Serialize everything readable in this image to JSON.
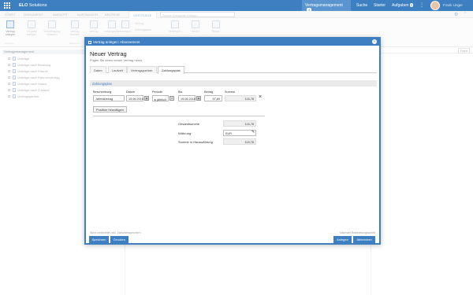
{
  "topbar": {
    "brand_strong": "ELO",
    "brand_rest": "Solutions",
    "module": "Vertragsmanagement",
    "module_badge": "4",
    "nav": [
      "Suche",
      "Starter",
      "Aufgaben"
    ],
    "tasks_badge": "0",
    "more": "⋮",
    "user": "Frank Unger"
  },
  "ribbon_tabs": {
    "tabs": [
      "START",
      "DOKUMENT",
      "ANSICHT",
      "AUSTAUSCH",
      "ARCHIVE",
      "VERTRÄGE"
    ],
    "search_placeholder": "Suche (Gesamte Ablage)",
    "settings_icon": "gear-icon",
    "collapse": "^"
  },
  "ribbon": {
    "buttons": [
      "Vertrag anlegen",
      "Vorgang anlegen",
      "Beauftragung erfassen",
      "Vertrag drucken",
      "Vertrag",
      "Zahlungsplan",
      "Kündigen",
      "Verlängern",
      "Weiter",
      "Report"
    ],
    "small_items": [
      "Vertrag",
      "Zahlungsplan"
    ],
    "groups": [
      "Erstellen",
      "Bearbeiten"
    ]
  },
  "tree": {
    "root": "Vertragsmanagement",
    "items": [
      "Verträge",
      "Verträge nach Beratung",
      "Verträge nach Partner",
      "Verträge nach Rahmenvertrag",
      "Verträge nach Status",
      "Verträge nach Zustand",
      "Vertragspartner"
    ]
  },
  "right_pane": {
    "feed_label": "Feed"
  },
  "dialog": {
    "title": "Vertrag anlegen: Abonnement",
    "heading": "Neuer Vertrag",
    "subheading": "Fügen Sie einen neuen Vertrag hinzu.",
    "tabs": [
      "Daten",
      "Laufzeit",
      "Vertragspartner",
      "Zahlungsplan"
    ],
    "active_tab": "Zahlungsplan",
    "section": "Zahlungsplan",
    "columns": [
      "Beschreibung",
      "Datum",
      "Periode",
      "Bis",
      "Betrag",
      "Summe"
    ],
    "row": {
      "beschreibung": "Jahresbetrag",
      "datum": "19.06.2018",
      "periode": "jährlich",
      "bis": "19.06.2018",
      "betrag": "57,89",
      "summe": "115,78"
    },
    "add_position": "Position hinzufügen",
    "gesamtsumme_label": "Gesamtsumme",
    "gesamtsumme": "115,78",
    "waehrung_label": "Währung",
    "waehrung": "EUR",
    "hauswaehrung_label": "Summe in Hauswährung",
    "hauswaehrung": "115,78",
    "footer_left": "Nicht vorbereitet, inkl. Zwischenspeichern",
    "footer_right": "Nächster Bearbeitungsschritt",
    "buttons": {
      "save": "Speichern",
      "print": "Drucken",
      "create": "Anlegen",
      "cancel": "Abbrechen"
    }
  },
  "colors": {
    "accent": "#3d7fc1"
  }
}
